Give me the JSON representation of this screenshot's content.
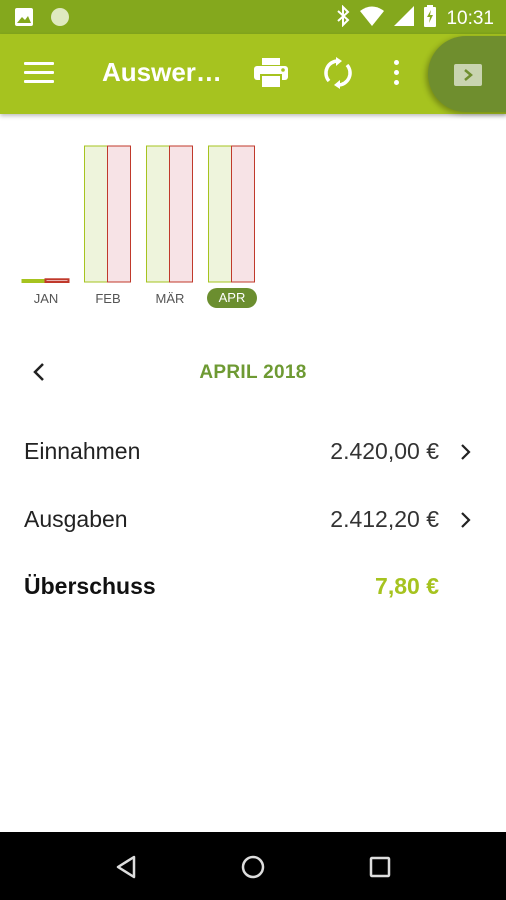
{
  "status_bar": {
    "time": "10:31",
    "left_icons": [
      "image-icon",
      "circle-notification-icon"
    ],
    "right_icons": [
      "bluetooth-icon",
      "wifi-icon",
      "signal-icon",
      "battery-icon"
    ]
  },
  "app_bar": {
    "title": "Auswer…",
    "actions": [
      "print-icon",
      "sync-icon",
      "more-vert-icon"
    ],
    "background": "#a6c31f"
  },
  "chart_data": {
    "type": "bar",
    "categories": [
      "JAN",
      "FEB",
      "MÄR",
      "APR"
    ],
    "selected": "APR",
    "series": [
      {
        "values": [
          0,
          1,
          1,
          1
        ],
        "color": "#eef4dc",
        "stroke": "#a6c31f"
      },
      {
        "values": [
          0.02,
          1,
          1,
          1
        ],
        "color": "#f7e3e6",
        "stroke": "#c0392b"
      }
    ],
    "ylim": [
      0,
      1
    ]
  },
  "month_nav": {
    "title": "APRIL 2018"
  },
  "summary": {
    "income_label": "Einnahmen",
    "income_amount": "2.420,00 €",
    "expense_label": "Ausgaben",
    "expense_amount": "2.412,20 €",
    "surplus_label": "Überschuss",
    "surplus_amount": "7,80 €"
  },
  "nav_bar": {
    "buttons": [
      "back-triangle-icon",
      "home-circle-icon",
      "recents-square-icon"
    ]
  },
  "colors": {
    "accent": "#a6c31f",
    "status_bar": "#84a81d",
    "month_title": "#6e9a33"
  }
}
